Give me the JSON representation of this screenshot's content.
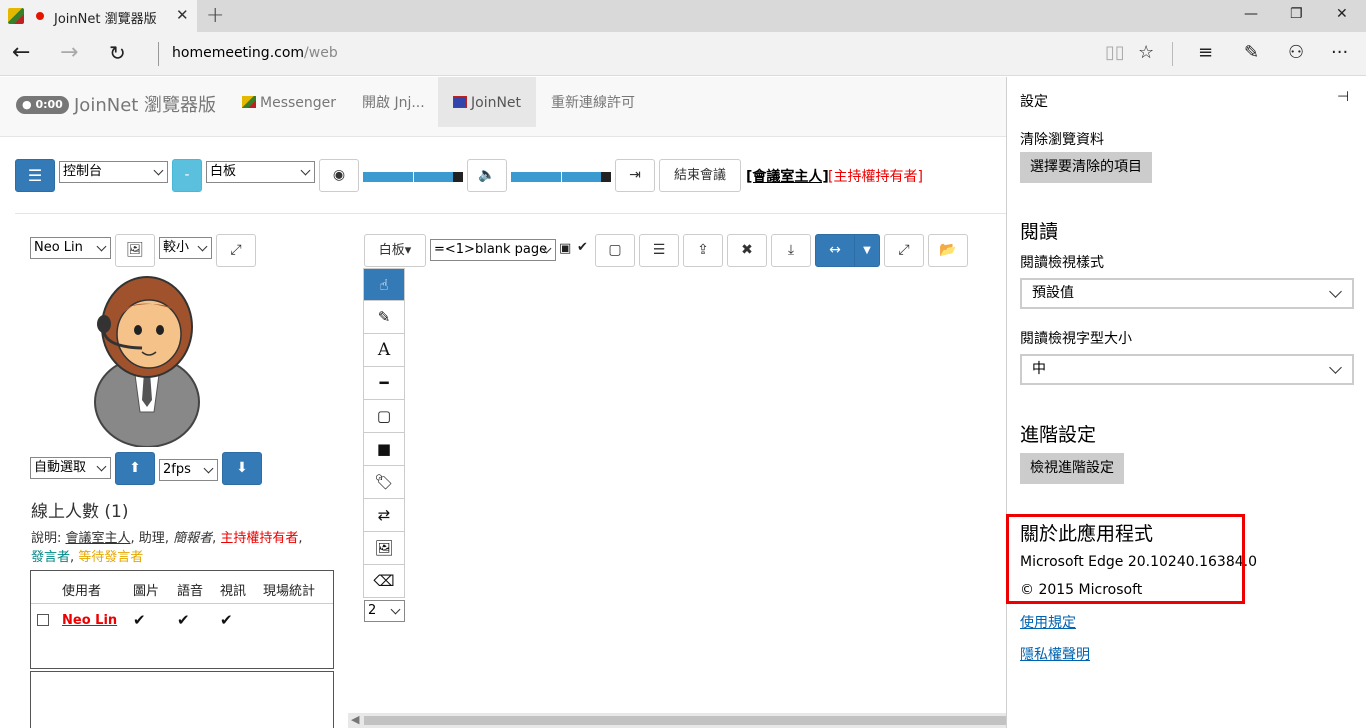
{
  "browser": {
    "tab_title": "JoinNet 瀏覽器版",
    "url_host": "homemeeting.com",
    "url_path": "/web"
  },
  "navbar": {
    "timer": "0:00",
    "brand": "JoinNet 瀏覽器版",
    "links": [
      "Messenger",
      "開啟 Jnj...",
      "JoinNet",
      "重新連線許可"
    ]
  },
  "toolbar": {
    "console_select": "控制台",
    "dash_label": "-",
    "whiteboard_select": "白板",
    "end_meeting": "結束會議",
    "host_link": "[會議室主人]",
    "host_role": "[主持權持有者]"
  },
  "video": {
    "user_select": "Neo Lin",
    "size_select": "較小",
    "auto_select": "自動選取",
    "fps_select": "2fps"
  },
  "online": {
    "title": "線上人數 (1)",
    "legend_prefix": "說明: ",
    "legend_host": "會議室主人",
    "legend_sep1": ", ",
    "legend_assistant": "助理",
    "legend_sep2": ", ",
    "legend_reporter": "簡報者",
    "legend_sep3": ", ",
    "legend_holder": "主持權持有者",
    "legend_sep4": ",",
    "legend_speaker": "發言者",
    "legend_sep5": ", ",
    "legend_waiting": "等待發言者",
    "columns": [
      "使用者",
      "圖片",
      "語音",
      "視訊",
      "現場統計"
    ],
    "rows": [
      {
        "name": "Neo Lin",
        "image": "✔",
        "voice": "✔",
        "video": "✔"
      }
    ]
  },
  "whiteboard": {
    "mode_button": "白板▾",
    "page_select": "=<1>blank page",
    "tools": [
      "hand-pointer",
      "pencil",
      "A",
      "line",
      "rect",
      "fill-rect",
      "tag",
      "retweet",
      "image",
      "eraser"
    ],
    "line_width": "2"
  },
  "settings": {
    "title": "設定",
    "clear_label": "清除瀏覽資料",
    "clear_button": "選擇要清除的項目",
    "reading_heading": "閱讀",
    "reading_style_label": "閱讀檢視樣式",
    "reading_style_value": "預設值",
    "reading_font_label": "閱讀檢視字型大小",
    "reading_font_value": "中",
    "advanced_heading": "進階設定",
    "advanced_button": "檢視進階設定",
    "about_heading": "關於此應用程式",
    "version": "Microsoft Edge 20.10240.16384.0",
    "copyright": "© 2015 Microsoft",
    "terms_link": "使用規定",
    "privacy_link": "隱私權聲明"
  },
  "colors": {
    "primary": "#337ab7",
    "info": "#5bc0de",
    "danger": "#e00000",
    "highlight_box": "#e00000"
  }
}
